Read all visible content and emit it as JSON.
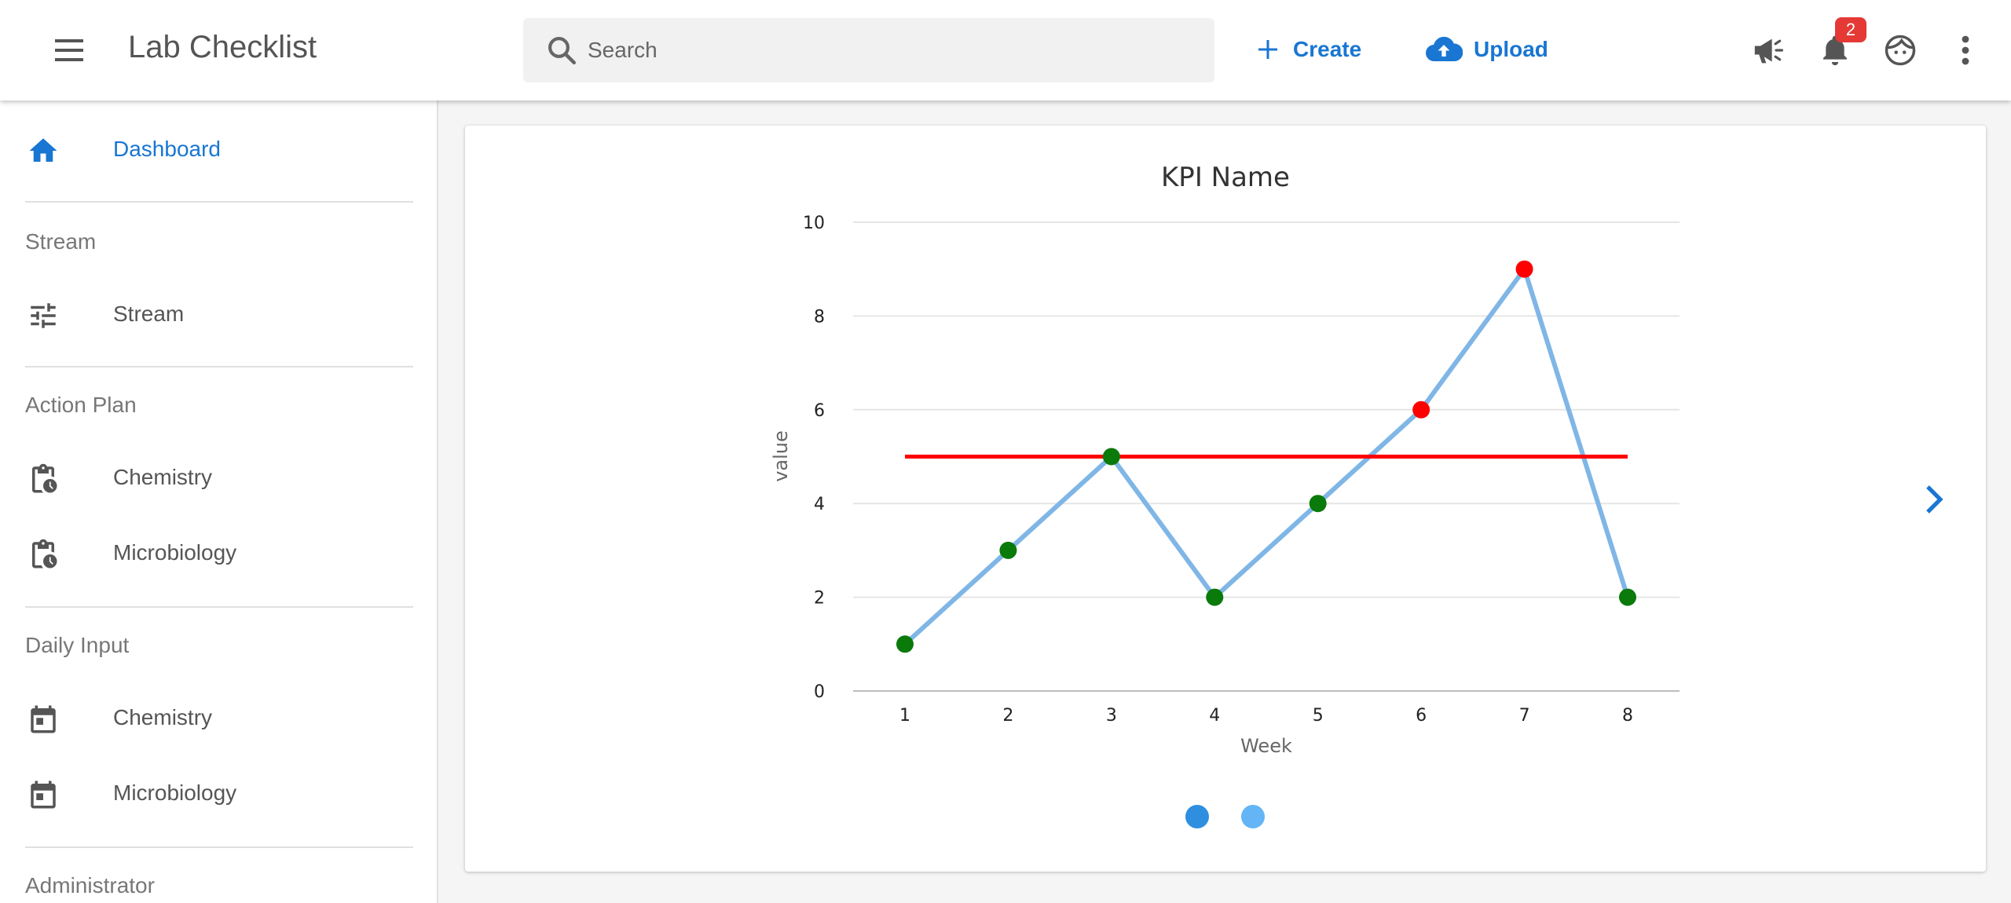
{
  "app": {
    "title": "Lab Checklist"
  },
  "search": {
    "placeholder": "Search"
  },
  "actions": {
    "create_label": "Create",
    "upload_label": "Upload"
  },
  "notifications": {
    "count": "2"
  },
  "sidebar": {
    "dashboard_label": "Dashboard",
    "sections": [
      {
        "title": "Stream",
        "items": [
          {
            "label": "Stream"
          }
        ]
      },
      {
        "title": "Action Plan",
        "items": [
          {
            "label": "Chemistry"
          },
          {
            "label": "Microbiology"
          }
        ]
      },
      {
        "title": "Daily Input",
        "items": [
          {
            "label": "Chemistry"
          },
          {
            "label": "Microbiology"
          }
        ]
      },
      {
        "title": "Administrator",
        "items": []
      }
    ]
  },
  "colors": {
    "accent": "#1976d2",
    "line": "#7fb6e6",
    "target": "#ff0000",
    "point_ok": "#0a7a0a",
    "point_bad": "#ff0000",
    "dot_active": "#2f8ee0",
    "dot_inactive": "#64b5f6"
  },
  "chart_data": {
    "type": "line",
    "title": "KPI Name",
    "xlabel": "Week",
    "ylabel": "value",
    "x": [
      1,
      2,
      3,
      4,
      5,
      6,
      7,
      8
    ],
    "series": [
      {
        "values": [
          1,
          3,
          5,
          2,
          4,
          6,
          9,
          2
        ]
      }
    ],
    "target": 5,
    "point_status": [
      "ok",
      "ok",
      "ok",
      "ok",
      "ok",
      "bad",
      "bad",
      "ok"
    ],
    "ylim": [
      0,
      10
    ],
    "yticks": [
      0,
      2,
      4,
      6,
      8,
      10
    ],
    "grid": true
  },
  "carousel": {
    "pages": 2,
    "active": 0
  }
}
